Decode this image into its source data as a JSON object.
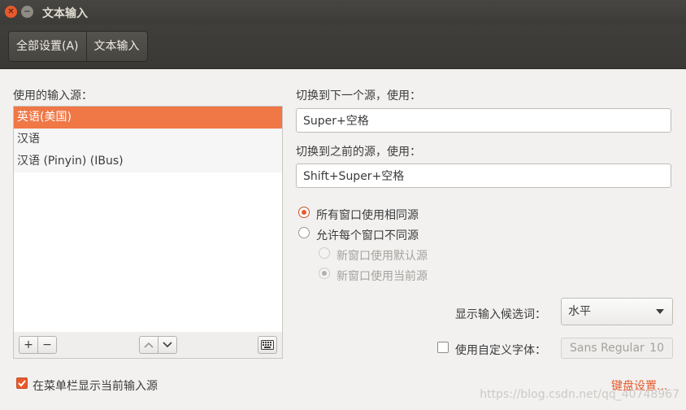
{
  "window": {
    "title": "文本输入"
  },
  "breadcrumb": [
    "全部设置(A)",
    "文本输入"
  ],
  "sources": {
    "label": "使用的输入源：",
    "items": [
      "英语(美国)",
      "汉语",
      "汉语 (Pinyin) (IBus)"
    ],
    "selected_index": 0,
    "toolbar": {
      "add": "+",
      "remove": "−"
    }
  },
  "shortcuts": {
    "next_label": "切换到下一个源，使用：",
    "next_value": "Super+空格",
    "prev_label": "切换到之前的源，使用：",
    "prev_value": "Shift+Super+空格"
  },
  "mode": {
    "same_label": "所有窗口使用相同源",
    "per_window_label": "允许每个窗口不同源",
    "new_default_label": "新窗口使用默认源",
    "new_current_label": "新窗口使用当前源",
    "selected": "same"
  },
  "candidates": {
    "label": "显示输入候选词：",
    "value": "水平"
  },
  "custom_font": {
    "label": "使用自定义字体：",
    "checked": false,
    "font_name": "Sans Regular",
    "font_size": "10"
  },
  "indicator": {
    "label": "在菜单栏显示当前输入源",
    "checked": true
  },
  "keyboard_link": "键盘设置...",
  "watermark": "https://blog.csdn.net/qq_40748967",
  "colors": {
    "accent": "#e9592b",
    "selection": "#f07746",
    "titlebar": "#3c3b37"
  }
}
